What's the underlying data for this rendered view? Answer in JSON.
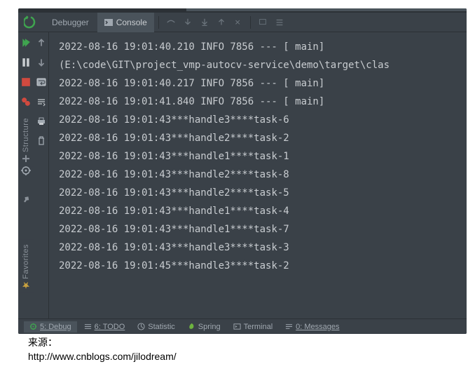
{
  "toolbar": {
    "debugger_label": "Debugger",
    "console_label": "Console"
  },
  "log": {
    "line1": "2022-08-16 19:01:40.210  INFO 7856 --- [           main]",
    "line2": " (E:\\code\\GIT\\project_vmp-autocv-service\\demo\\target\\clas",
    "line3": "2022-08-16 19:01:40.217  INFO 7856 --- [           main]",
    "line4": "2022-08-16 19:01:41.840  INFO 7856 --- [           main]",
    "line5": "2022-08-16 19:01:43***handle3****task-6",
    "line6": "2022-08-16 19:01:43***handle2****task-2",
    "line7": "2022-08-16 19:01:43***handle1****task-1",
    "line8": "2022-08-16 19:01:43***handle2****task-8",
    "line9": "2022-08-16 19:01:43***handle2****task-5",
    "line10": "2022-08-16 19:01:43***handle1****task-4",
    "line11": "2022-08-16 19:01:43***handle1****task-7",
    "line12": "2022-08-16 19:01:43***handle3****task-3",
    "line13": "2022-08-16 19:01:45***handle3****task-2"
  },
  "sidebar": {
    "structure": "Structure",
    "favorites": "Favorites"
  },
  "statusbar": {
    "debug": "5: Debug",
    "todo": "6: TODO",
    "statistic": "Statistic",
    "spring": "Spring",
    "terminal": "Terminal",
    "messages": "0: Messages"
  },
  "caption": {
    "source": "来源：",
    "url": "http://www.cnblogs.com/jilodream/"
  }
}
